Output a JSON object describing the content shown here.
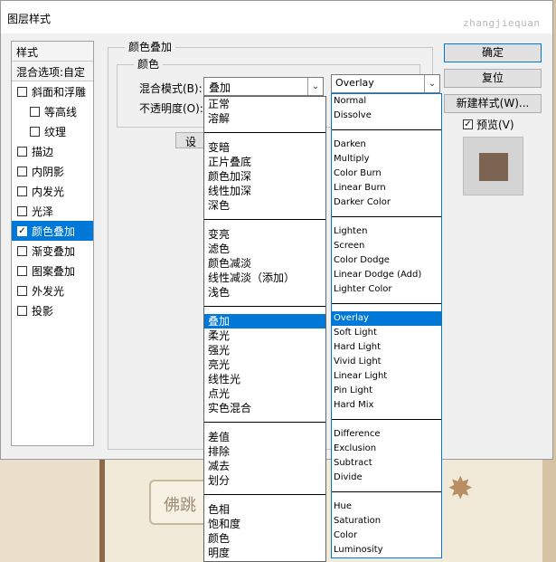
{
  "window": {
    "title": "图层样式",
    "watermark": "zhangjiequan"
  },
  "styles": {
    "header": "样式",
    "blend_options": "混合选项:自定",
    "items": [
      {
        "label": "斜面和浮雕",
        "checked": false,
        "sub": false
      },
      {
        "label": "等高线",
        "checked": false,
        "sub": true
      },
      {
        "label": "纹理",
        "checked": false,
        "sub": true
      },
      {
        "label": "描边",
        "checked": false,
        "sub": false
      },
      {
        "label": "内阴影",
        "checked": false,
        "sub": false
      },
      {
        "label": "内发光",
        "checked": false,
        "sub": false
      },
      {
        "label": "光泽",
        "checked": false,
        "sub": false
      },
      {
        "label": "颜色叠加",
        "checked": true,
        "sub": false,
        "active": true
      },
      {
        "label": "渐变叠加",
        "checked": false,
        "sub": false
      },
      {
        "label": "图案叠加",
        "checked": false,
        "sub": false
      },
      {
        "label": "外发光",
        "checked": false,
        "sub": false
      },
      {
        "label": "投影",
        "checked": false,
        "sub": false
      }
    ]
  },
  "overlay": {
    "group_title": "颜色叠加",
    "color_group_title": "颜色",
    "mode_label": "混合模式(B):",
    "opacity_label": "不透明度(O):",
    "settings_button": "设置",
    "mode_value_cn": "叠加",
    "mode_value_en": "Overlay",
    "overlay_color": "#7b6452"
  },
  "blend_modes_cn": [
    [
      "正常",
      "溶解"
    ],
    [
      "变暗",
      "正片叠底",
      "颜色加深",
      "线性加深",
      "深色"
    ],
    [
      "变亮",
      "滤色",
      "颜色减淡",
      "线性减淡（添加）",
      "浅色"
    ],
    [
      "叠加",
      "柔光",
      "强光",
      "亮光",
      "线性光",
      "点光",
      "实色混合"
    ],
    [
      "差值",
      "排除",
      "减去",
      "划分"
    ],
    [
      "色相",
      "饱和度",
      "颜色",
      "明度"
    ]
  ],
  "blend_modes_en": [
    [
      "Normal",
      "Dissolve"
    ],
    [
      "Darken",
      "Multiply",
      "Color Burn",
      "Linear Burn",
      "Darker Color"
    ],
    [
      "Lighten",
      "Screen",
      "Color Dodge",
      "Linear Dodge (Add)",
      "Lighter Color"
    ],
    [
      "Overlay",
      "Soft Light",
      "Hard Light",
      "Vivid Light",
      "Linear Light",
      "Pin Light",
      "Hard Mix"
    ],
    [
      "Difference",
      "Exclusion",
      "Subtract",
      "Divide"
    ],
    [
      "Hue",
      "Saturation",
      "Color",
      "Luminosity"
    ]
  ],
  "buttons": {
    "ok": "确定",
    "reset": "复位",
    "new_style": "新建样式(W)...",
    "preview": "预览(V)",
    "preview_checked": true
  },
  "background": {
    "card_text": "佛跳"
  }
}
